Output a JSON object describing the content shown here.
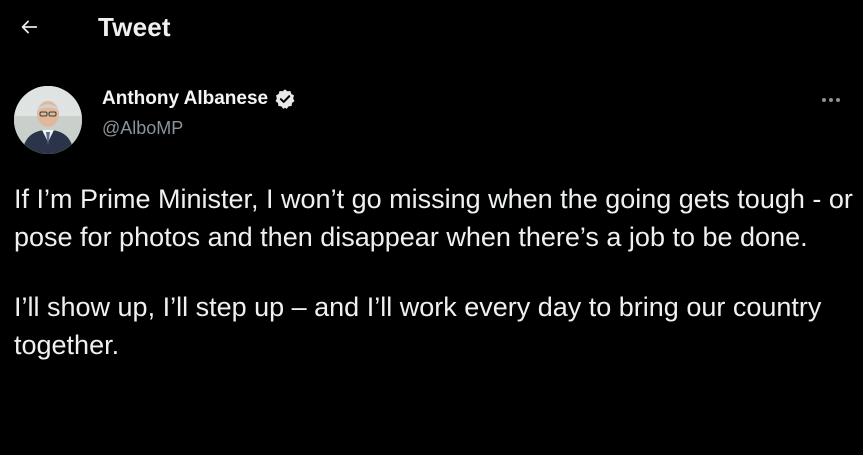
{
  "header": {
    "back_icon": "arrow-left-icon",
    "title": "Tweet"
  },
  "author": {
    "name": "Anthony Albanese",
    "handle": "@AlboMP",
    "verified_icon": "verified-badge-icon",
    "avatar_icon": "profile-photo"
  },
  "more_icon": "more-options-icon",
  "tweet": {
    "paragraphs": [
      "If I’m Prime Minister, I won’t go missing when the going gets tough - or pose for photos and then disappear when there’s a job to be done.",
      "I’ll show up, I’ll step up – and I’ll work every day to bring our country together."
    ]
  },
  "colors": {
    "background": "#000000",
    "text": "#e7e9ea",
    "secondary_text": "#8b9298"
  }
}
